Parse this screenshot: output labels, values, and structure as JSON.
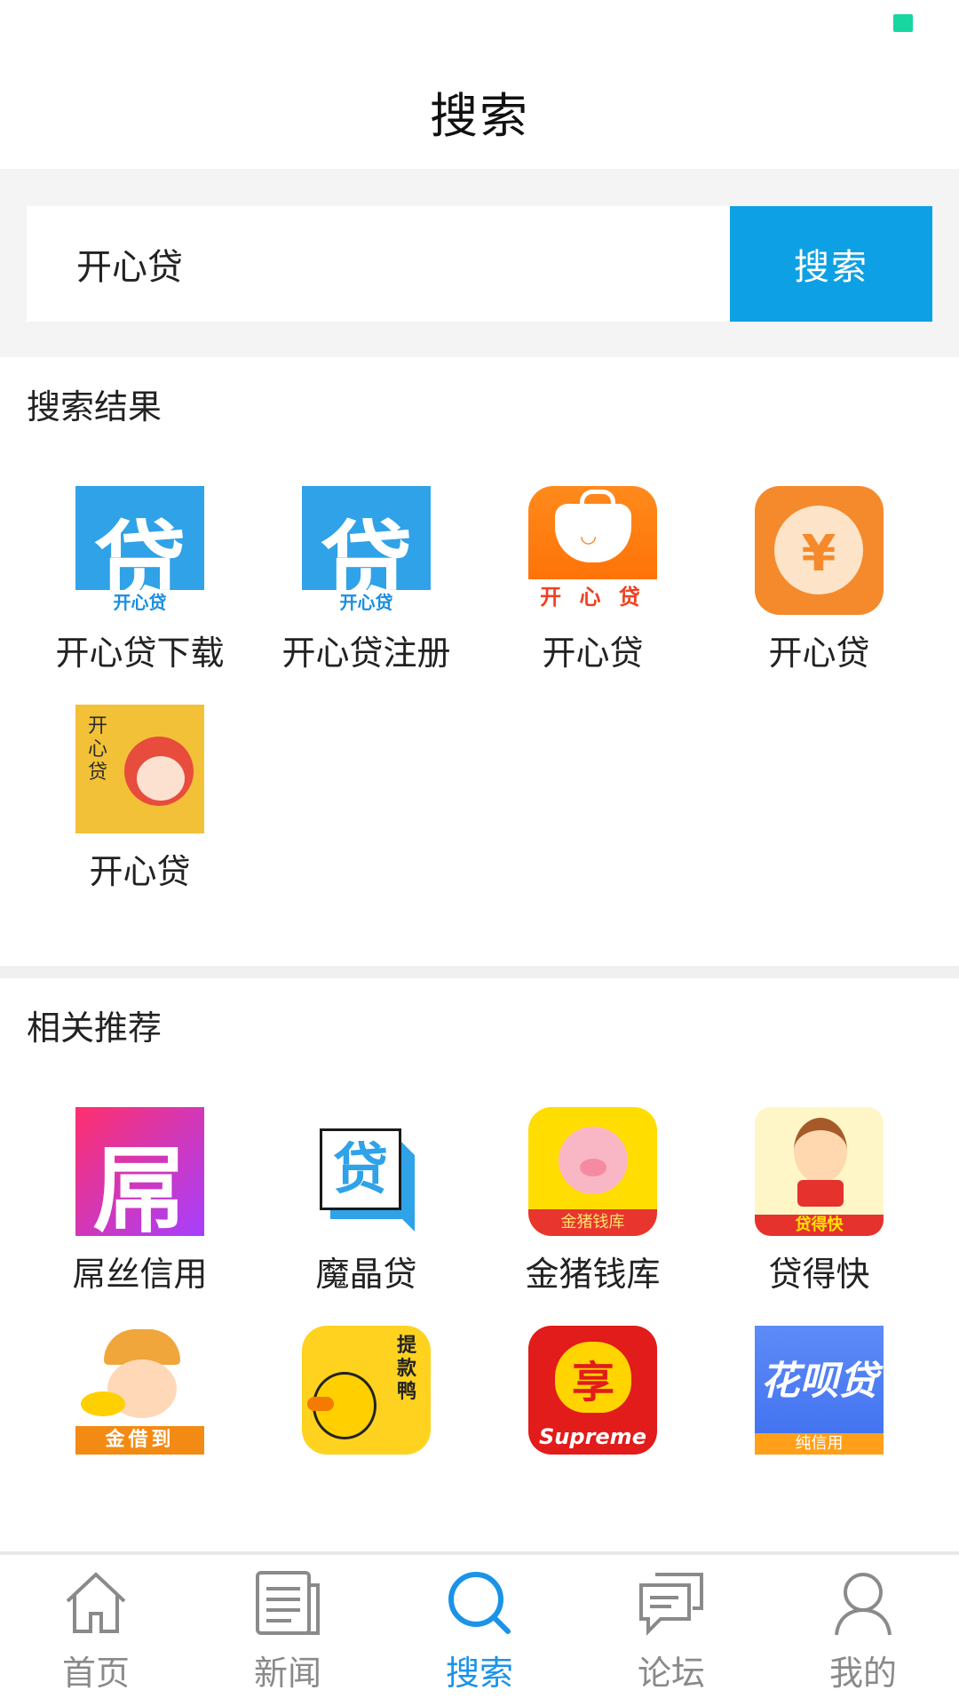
{
  "header": {
    "title": "搜索"
  },
  "search": {
    "query": "开心贷",
    "button_label": "搜索"
  },
  "results": {
    "title": "搜索结果",
    "items": [
      {
        "label": "开心贷下载",
        "icon": "blue-dai-icon",
        "icon_text": "贷",
        "icon_subtext": "开心贷"
      },
      {
        "label": "开心贷注册",
        "icon": "blue-dai-icon",
        "icon_text": "贷",
        "icon_subtext": "开心贷"
      },
      {
        "label": "开心贷",
        "icon": "orange-bag-icon",
        "icon_subtext": "开 心 贷"
      },
      {
        "label": "开心贷",
        "icon": "orange-yen-icon",
        "icon_text": "¥"
      },
      {
        "label": "开心贷",
        "icon": "yellow-cartoon-icon",
        "icon_text": "开心贷"
      }
    ]
  },
  "recommend": {
    "title": "相关推荐",
    "items": [
      {
        "label": "屌丝信用",
        "icon": "pink-diao-icon",
        "icon_text": "屌"
      },
      {
        "label": "魔晶贷",
        "icon": "cube-dai-icon",
        "icon_text": "贷"
      },
      {
        "label": "金猪钱库",
        "icon": "pig-icon",
        "icon_subtext": "金猪钱库"
      },
      {
        "label": "贷得快",
        "icon": "runner-icon",
        "icon_subtext": "贷得快"
      },
      {
        "label": "",
        "icon": "gold-boy-icon",
        "icon_subtext": "金借到"
      },
      {
        "label": "",
        "icon": "duck-icon",
        "icon_text": "提款鸭"
      },
      {
        "label": "",
        "icon": "supreme-icon",
        "icon_text": "享",
        "icon_subtext": "Supreme"
      },
      {
        "label": "",
        "icon": "huabei-icon",
        "icon_text": "花呗贷",
        "icon_subtext": "纯信用"
      }
    ]
  },
  "nav": {
    "items": [
      {
        "label": "首页",
        "icon": "home-icon",
        "active": false
      },
      {
        "label": "新闻",
        "icon": "news-icon",
        "active": false
      },
      {
        "label": "搜索",
        "icon": "search-icon",
        "active": true
      },
      {
        "label": "论坛",
        "icon": "forum-icon",
        "active": false
      },
      {
        "label": "我的",
        "icon": "profile-icon",
        "active": false
      }
    ]
  },
  "colors": {
    "accent": "#1a93e8",
    "search_button": "#0ea0e4",
    "inactive": "#8a8a8a",
    "status_dot": "#18d6a0"
  }
}
